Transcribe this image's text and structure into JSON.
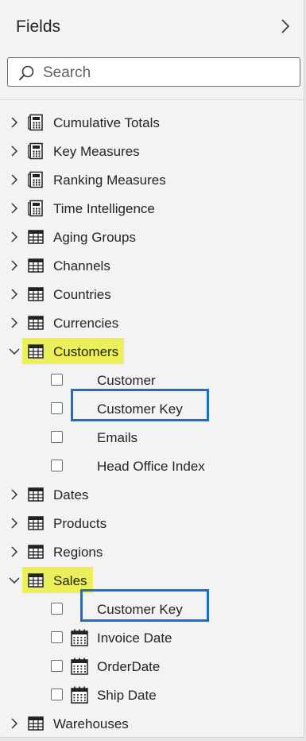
{
  "pane": {
    "title": "Fields",
    "search_placeholder": "Search"
  },
  "colors": {
    "highlight_yellow": "#ebef59",
    "callout_blue": "#1a6ed1",
    "panel_bg": "#f3f3f3"
  },
  "tables": [
    {
      "name": "Cumulative Totals",
      "icon": "calculator-icon",
      "expanded": false
    },
    {
      "name": "Key Measures",
      "icon": "calculator-icon",
      "expanded": false
    },
    {
      "name": "Ranking Measures",
      "icon": "calculator-icon",
      "expanded": false
    },
    {
      "name": "Time Intelligence",
      "icon": "calculator-icon",
      "expanded": false
    },
    {
      "name": "Aging Groups",
      "icon": "table-icon",
      "expanded": false
    },
    {
      "name": "Channels",
      "icon": "table-icon",
      "expanded": false
    },
    {
      "name": "Countries",
      "icon": "table-icon",
      "expanded": false
    },
    {
      "name": "Currencies",
      "icon": "table-icon",
      "expanded": false
    },
    {
      "name": "Customers",
      "icon": "table-icon",
      "expanded": true,
      "highlighted": true,
      "fields": [
        {
          "name": "Customer",
          "icon": "none",
          "checked": false
        },
        {
          "name": "Customer Key",
          "icon": "none",
          "checked": false,
          "boxed": true
        },
        {
          "name": "Emails",
          "icon": "none",
          "checked": false
        },
        {
          "name": "Head Office Index",
          "icon": "none",
          "checked": false
        }
      ]
    },
    {
      "name": "Dates",
      "icon": "table-icon",
      "expanded": false
    },
    {
      "name": "Products",
      "icon": "table-icon",
      "expanded": false
    },
    {
      "name": "Regions",
      "icon": "table-icon",
      "expanded": false
    },
    {
      "name": "Sales",
      "icon": "table-icon",
      "expanded": true,
      "highlighted": true,
      "fields": [
        {
          "name": "Customer Key",
          "icon": "none",
          "checked": false,
          "boxed": true
        },
        {
          "name": "Invoice Date",
          "icon": "calendar-icon",
          "checked": false
        },
        {
          "name": "OrderDate",
          "icon": "calendar-icon",
          "checked": false
        },
        {
          "name": "Ship Date",
          "icon": "calendar-icon",
          "checked": false
        }
      ]
    },
    {
      "name": "Warehouses",
      "icon": "table-icon",
      "expanded": false
    }
  ]
}
